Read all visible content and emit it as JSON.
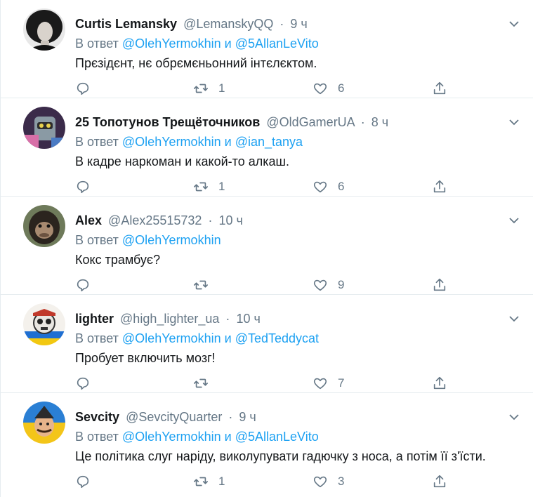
{
  "tweets": [
    {
      "name": "Curtis Lemansky",
      "handle": "@LemanskyQQ",
      "dot": "·",
      "time": "9 ч",
      "reply_prefix": "В ответ",
      "mentions": [
        "@OlehYermokhin",
        "@5AllanLeVito"
      ],
      "connector": "и",
      "text": "Прєзідєнт, нє обрємєньонний інтєлєктом.",
      "retweets": "1",
      "likes": "6",
      "avatar": "curly-hair-portrait"
    },
    {
      "name": "25 Топотунов Трещёточников",
      "handle": "@OldGamerUA",
      "dot": "·",
      "time": "8 ч",
      "reply_prefix": "В ответ",
      "mentions": [
        "@OlehYermokhin",
        "@ian_tanya"
      ],
      "connector": "и",
      "text": "В кадре наркоман и какой-то алкаш.",
      "retweets": "1",
      "likes": "6",
      "avatar": "cartoon-robot"
    },
    {
      "name": "Alex",
      "handle": "@Alex25515732",
      "dot": "·",
      "time": "10 ч",
      "reply_prefix": "В ответ",
      "mentions": [
        "@OlehYermokhin"
      ],
      "connector": "",
      "text": "Кокс трамбує?",
      "retweets": "",
      "likes": "9",
      "avatar": "chimpanzee"
    },
    {
      "name": "lighter",
      "handle": "@high_lighter_ua",
      "dot": "·",
      "time": "10 ч",
      "reply_prefix": "В ответ",
      "mentions": [
        "@OlehYermokhin",
        "@TedTeddycat"
      ],
      "connector": "и",
      "text": "Пробует включить мозг!",
      "retweets": "",
      "likes": "7",
      "avatar": "skull-mascot"
    },
    {
      "name": "Sevcity",
      "handle": "@SevcityQuarter",
      "dot": "·",
      "time": "9 ч",
      "reply_prefix": "В ответ",
      "mentions": [
        "@OlehYermokhin",
        "@5AllanLeVito"
      ],
      "connector": "и",
      "text": "Це політика слуг наріду, виколупувати гадючку з носа, а потім її з'їсти.",
      "retweets": "1",
      "likes": "3",
      "avatar": "cossack-cartoon"
    }
  ],
  "colors": {
    "accent": "#1da1f2",
    "muted": "#657786",
    "text": "#14171a",
    "border": "#e6ecf0"
  },
  "icons": {
    "reply": "reply-icon",
    "retweet": "retweet-icon",
    "like": "heart-icon",
    "share": "share-icon",
    "menu": "chevron-down-icon"
  }
}
